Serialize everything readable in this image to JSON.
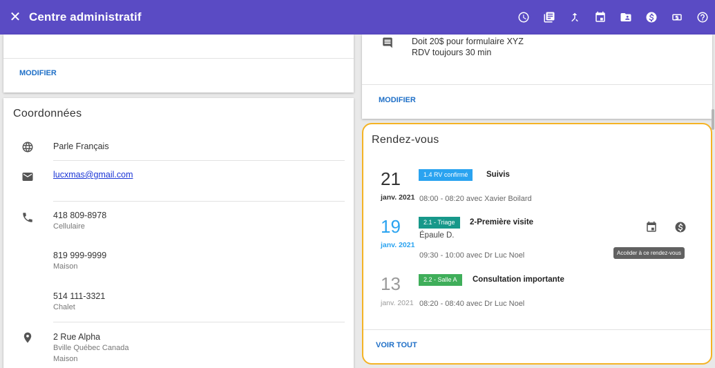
{
  "header": {
    "title": "Centre administratif",
    "icons": [
      "clock-icon",
      "book-icon",
      "merge-icon",
      "calendar-icon",
      "folder-account-icon",
      "dollar-circle-icon",
      "money-icon",
      "help-icon"
    ]
  },
  "colors": {
    "appbar": "#5a4bc4",
    "link": "#1e6fc7",
    "highlight_border": "#f4b324",
    "badge_confirmed": "#2aa3f0",
    "badge_triage": "#17988a",
    "badge_salle": "#3fae5a",
    "today": "#2aa3f0"
  },
  "left_top_card": {
    "modify_label": "MODIFIER"
  },
  "coordonnees": {
    "title": "Coordonnées",
    "language": "Parle Français",
    "email": "lucxmas@gmail.com",
    "phones": [
      {
        "number": "418 809-8978",
        "type": "Cellulaire"
      },
      {
        "number": "819 999-9999",
        "type": "Maison"
      },
      {
        "number": "514 111-3321",
        "type": "Chalet"
      }
    ],
    "address": {
      "line1": "2 Rue Alpha",
      "line2": "Bville Québec Canada",
      "type": "Maison"
    }
  },
  "right_top_card": {
    "note_lines": [
      "Doit 20$ pour formulaire XYZ",
      "RDV toujours 30 min"
    ],
    "modify_label": "MODIFIER"
  },
  "rendez_vous": {
    "title": "Rendez-vous",
    "items": [
      {
        "day": "21",
        "month": "janv. 2021",
        "badge": "1.4 RV confirmé",
        "title": "Suivis",
        "subtitle": "",
        "time": "08:00 - 08:20 avec Xavier Boilard",
        "state": "past"
      },
      {
        "day": "19",
        "month": "janv. 2021",
        "badge": "2.1 - Triage",
        "title": "2-Première visite",
        "subtitle": "Épaule D.",
        "time": "09:30 - 10:00 avec Dr Luc Noel",
        "state": "today"
      },
      {
        "day": "13",
        "month": "janv. 2021",
        "badge": "2.2 - Salle A",
        "title": "Consultation importante",
        "subtitle": "",
        "time": "08:20 - 08:40 avec Dr Luc Noel",
        "state": "past-faded"
      }
    ],
    "tooltip": "Accéder à ce rendez-vous",
    "see_all_label": "VOIR TOUT"
  }
}
